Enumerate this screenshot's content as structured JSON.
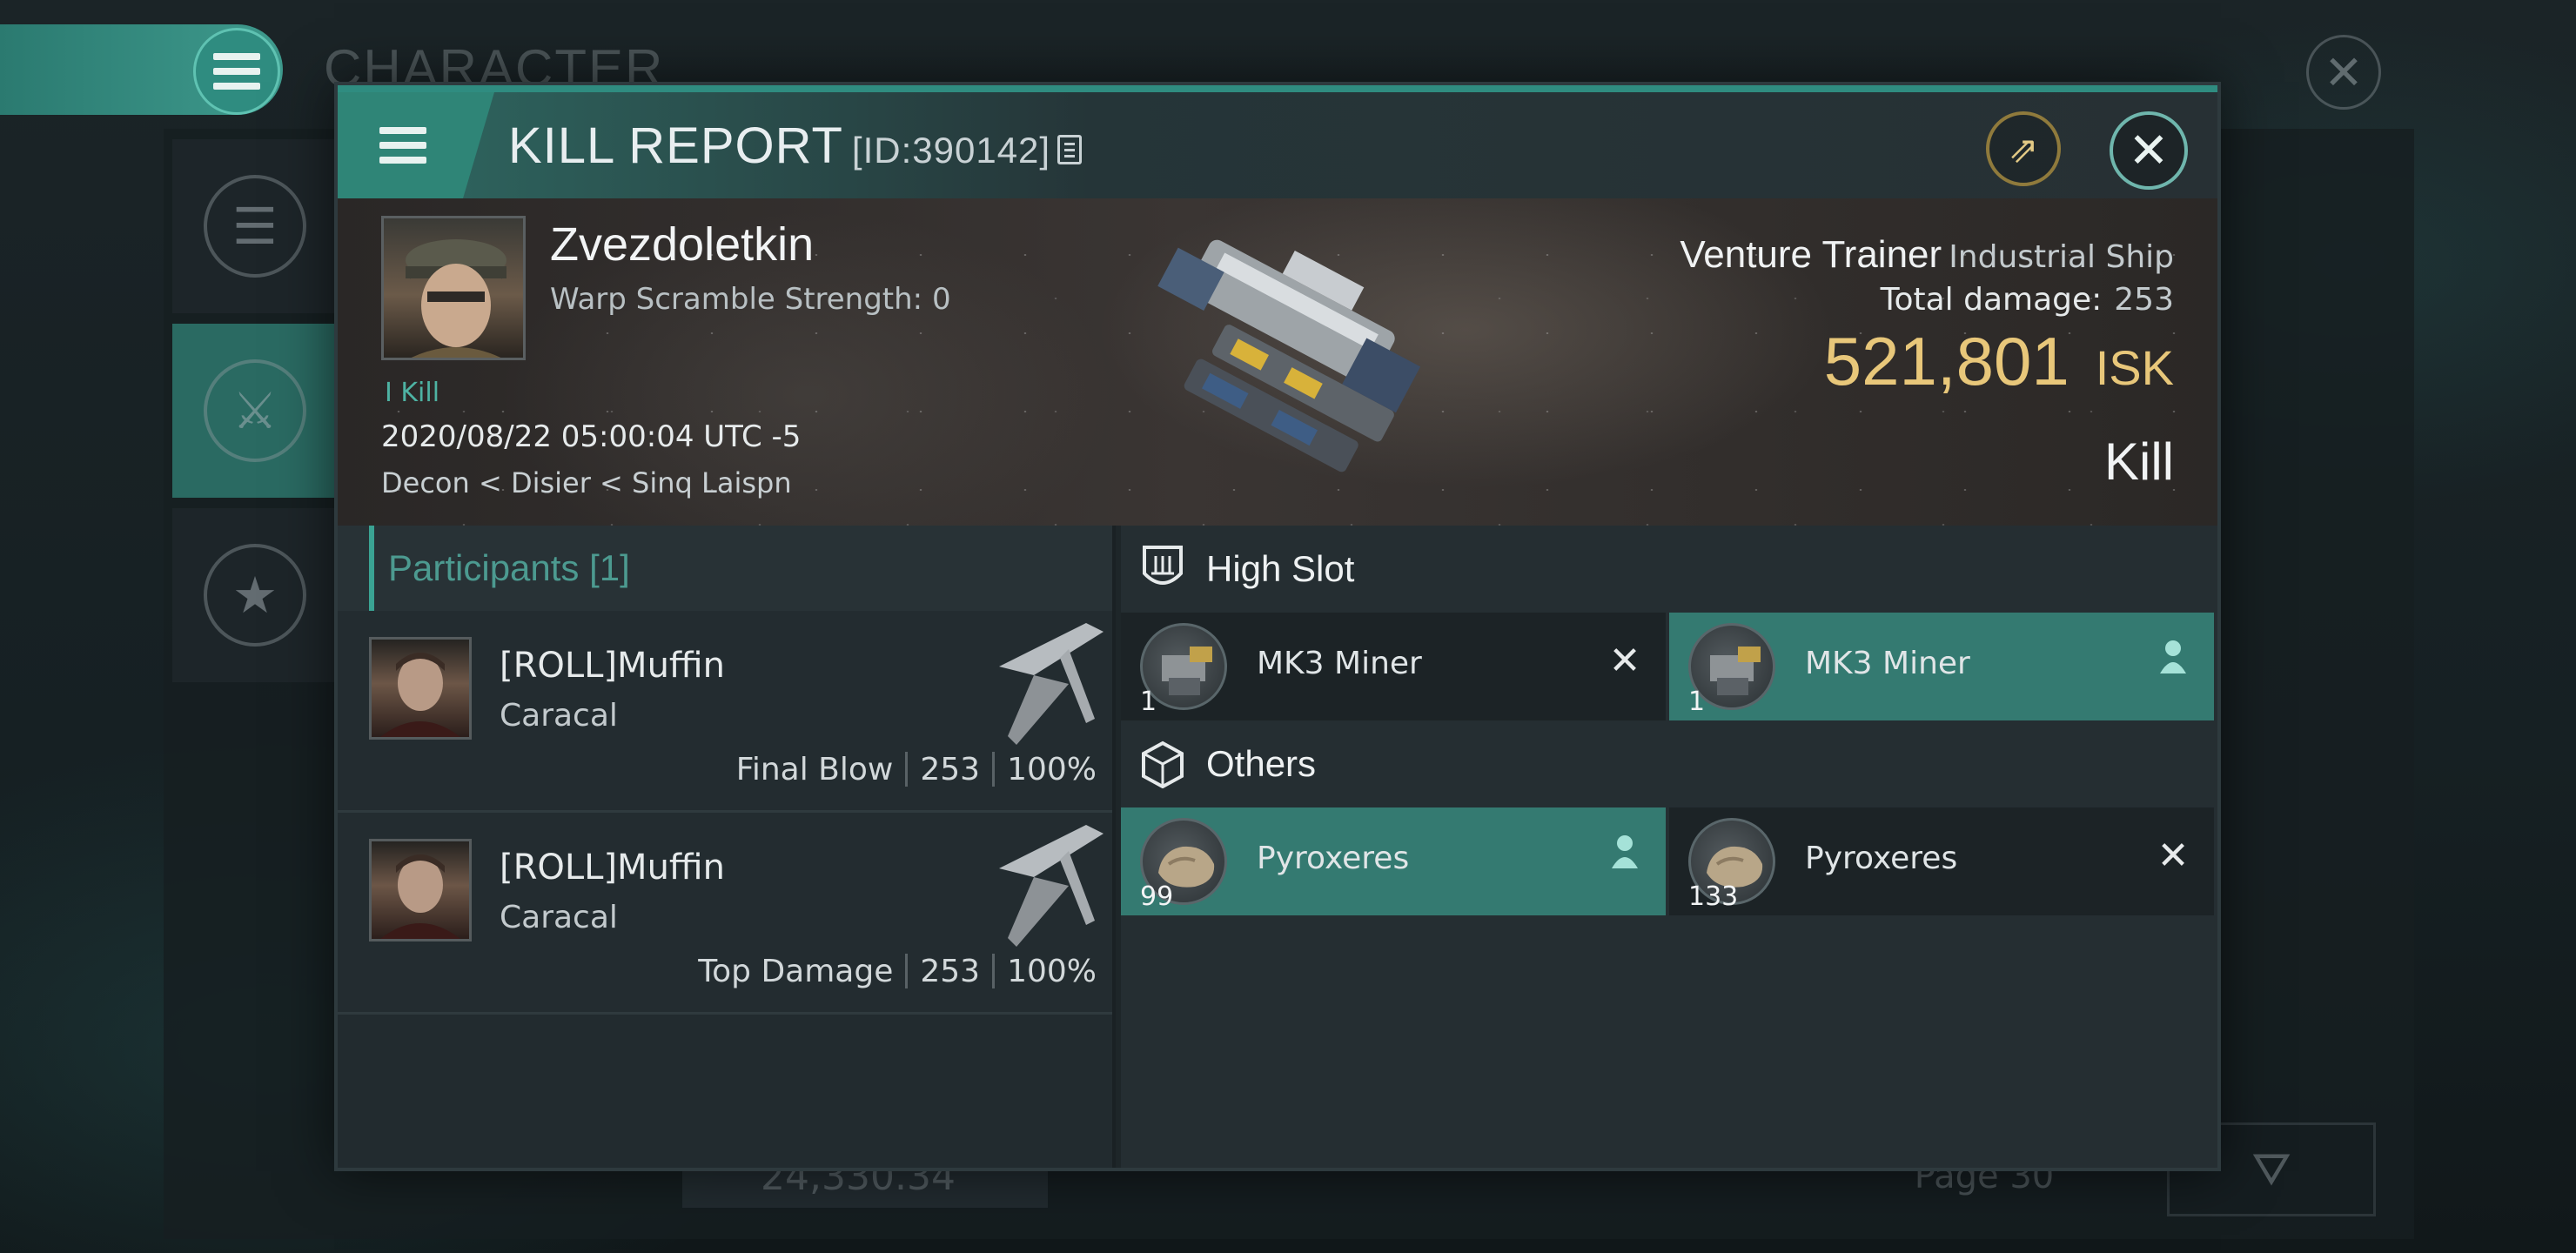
{
  "background": {
    "screen_title": "CHARACTER",
    "balance": "24,330.34",
    "page": "Page 30"
  },
  "modal": {
    "title": "KILL REPORT",
    "id_label": "[ID:390142]"
  },
  "victim": {
    "name": "Zvezdoletkin",
    "warp_scramble": "Warp Scramble Strength: 0",
    "kill_tag": "I Kill",
    "datetime": "2020/08/22 05:00:04 UTC -5",
    "location": "Decon < Disier < Sinq Laispn",
    "ship_name": "Venture Trainer",
    "ship_class": "Industrial Ship",
    "total_damage_label": "Total damage:",
    "total_damage_value": "253",
    "isk_value": "521,801",
    "isk_unit": "ISK",
    "result": "Kill"
  },
  "participants": {
    "header": "Participants [1]",
    "rows": [
      {
        "name": "[ROLL]Muffin",
        "ship": "Caracal",
        "role": "Final Blow",
        "damage": "253",
        "percent": "100%"
      },
      {
        "name": "[ROLL]Muffin",
        "ship": "Caracal",
        "role": "Top Damage",
        "damage": "253",
        "percent": "100%"
      }
    ]
  },
  "slots": {
    "high_slot_label": "High Slot",
    "others_label": "Others",
    "high_slot_items": [
      {
        "name": "MK3 Miner",
        "qty": "1",
        "status": "destroyed",
        "status_icon": "close-icon"
      },
      {
        "name": "MK3 Miner",
        "qty": "1",
        "status": "dropped",
        "status_icon": "person-icon"
      }
    ],
    "other_items": [
      {
        "name": "Pyroxeres",
        "qty": "99",
        "status": "dropped",
        "status_icon": "person-icon"
      },
      {
        "name": "Pyroxeres",
        "qty": "133",
        "status": "destroyed",
        "status_icon": "close-icon"
      }
    ]
  },
  "colors": {
    "accent": "#2f8c80",
    "isk": "#e8c77a",
    "dropped_bg": "#347a71"
  }
}
